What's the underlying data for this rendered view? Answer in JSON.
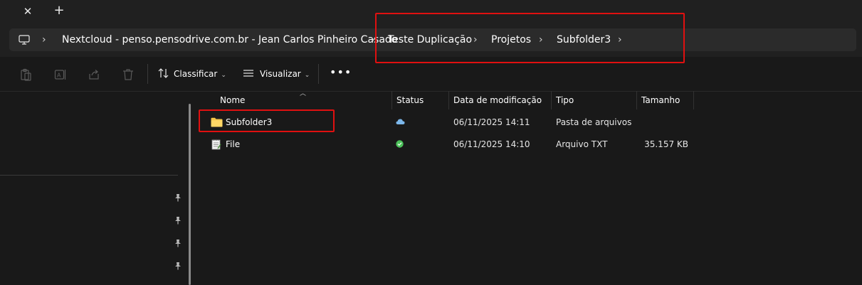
{
  "tabs": {
    "close_symbol": "✕",
    "new_symbol": "+"
  },
  "breadcrumb": {
    "items": [
      "Nextcloud - penso.pensodrive.com.br - Jean Carlos Pinheiro Casado",
      "Teste Duplicação",
      "Projetos",
      "Subfolder3"
    ],
    "separator": "›"
  },
  "toolbar": {
    "sort_label": "Classificar",
    "view_label": "Visualizar",
    "more_label": "•••"
  },
  "columns": {
    "name": "Nome",
    "status": "Status",
    "date": "Data de modificação",
    "type": "Tipo",
    "size": "Tamanho"
  },
  "files": [
    {
      "name": "Subfolder3",
      "status_icon": "cloud-icon",
      "date": "06/11/2025 14:11",
      "type": "Pasta de arquivos",
      "size": ""
    },
    {
      "name": "File",
      "status_icon": "check-icon",
      "date": "06/11/2025 14:10",
      "type": "Arquivo TXT",
      "size": "35.157 KB"
    }
  ],
  "colors": {
    "background": "#191919",
    "chrome": "#202020",
    "address_bar": "#2b2b2b",
    "annotation": "#e01010",
    "folder": "#f4c54a",
    "sync_ok": "#4cc25a",
    "cloud": "#7cb7ea"
  },
  "icons": {
    "navpane_pins": [
      "pin-icon",
      "pin-icon",
      "pin-icon",
      "pin-icon"
    ]
  }
}
